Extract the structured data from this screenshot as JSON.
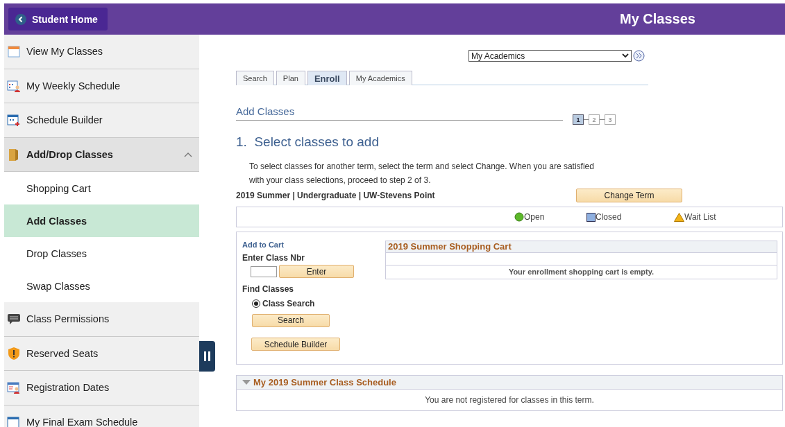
{
  "header": {
    "back_button": "Student Home",
    "title": "My Classes"
  },
  "sidebar": {
    "items": [
      {
        "label": "View My Classes",
        "expanded": false
      },
      {
        "label": "My Weekly Schedule",
        "expanded": false
      },
      {
        "label": "Schedule Builder",
        "expanded": false
      },
      {
        "label": "Add/Drop Classes",
        "expanded": true,
        "children": [
          {
            "label": "Shopping Cart",
            "selected": false
          },
          {
            "label": "Add Classes",
            "selected": true
          },
          {
            "label": "Drop Classes",
            "selected": false
          },
          {
            "label": "Swap Classes",
            "selected": false
          }
        ]
      },
      {
        "label": "Class Permissions",
        "expanded": false
      },
      {
        "label": "Reserved Seats",
        "expanded": false
      },
      {
        "label": "Registration Dates",
        "expanded": false
      },
      {
        "label": "My Final Exam Schedule",
        "expanded": false
      }
    ]
  },
  "nav_select": {
    "value": "My Academics"
  },
  "tabs": [
    {
      "label": "Search",
      "selected": false
    },
    {
      "label": "Plan",
      "selected": false
    },
    {
      "label": "Enroll",
      "selected": true
    },
    {
      "label": "My Academics",
      "selected": false
    }
  ],
  "section_title": "Add Classes",
  "steps": [
    {
      "label": "1",
      "selected": true
    },
    {
      "label": "2",
      "selected": false
    },
    {
      "label": "3",
      "selected": false
    }
  ],
  "heading": "1.  Select classes to add",
  "instructions": "To select classes for another term, select the term and select Change.  When you are satisfied with your class selections, proceed to step 2 of 3.",
  "term": "2019 Summer | Undergraduate | UW-Stevens Point",
  "change_term_button": "Change Term",
  "legend": [
    {
      "label": "Open",
      "kind": "circle",
      "color": "#5cb82a"
    },
    {
      "label": "Closed",
      "kind": "square",
      "color": "#8fb0e0"
    },
    {
      "label": "Wait List",
      "kind": "triangle",
      "color": "#f2b318"
    }
  ],
  "add_panel": {
    "title": "Add to Cart",
    "enter_label": "Enter Class Nbr",
    "enter_button": "Enter",
    "find_label": "Find Classes",
    "options": [
      {
        "label": "Class Search",
        "selected": true
      }
    ],
    "search_button": "Search",
    "schedule_builder_button": "Schedule Builder"
  },
  "shopping_cart": {
    "title": "2019 Summer Shopping Cart",
    "message": "Your enrollment shopping cart is empty."
  },
  "schedule": {
    "title": "My 2019 Summer Class Schedule",
    "expanded": true,
    "message": "You are not registered for classes in this term."
  }
}
